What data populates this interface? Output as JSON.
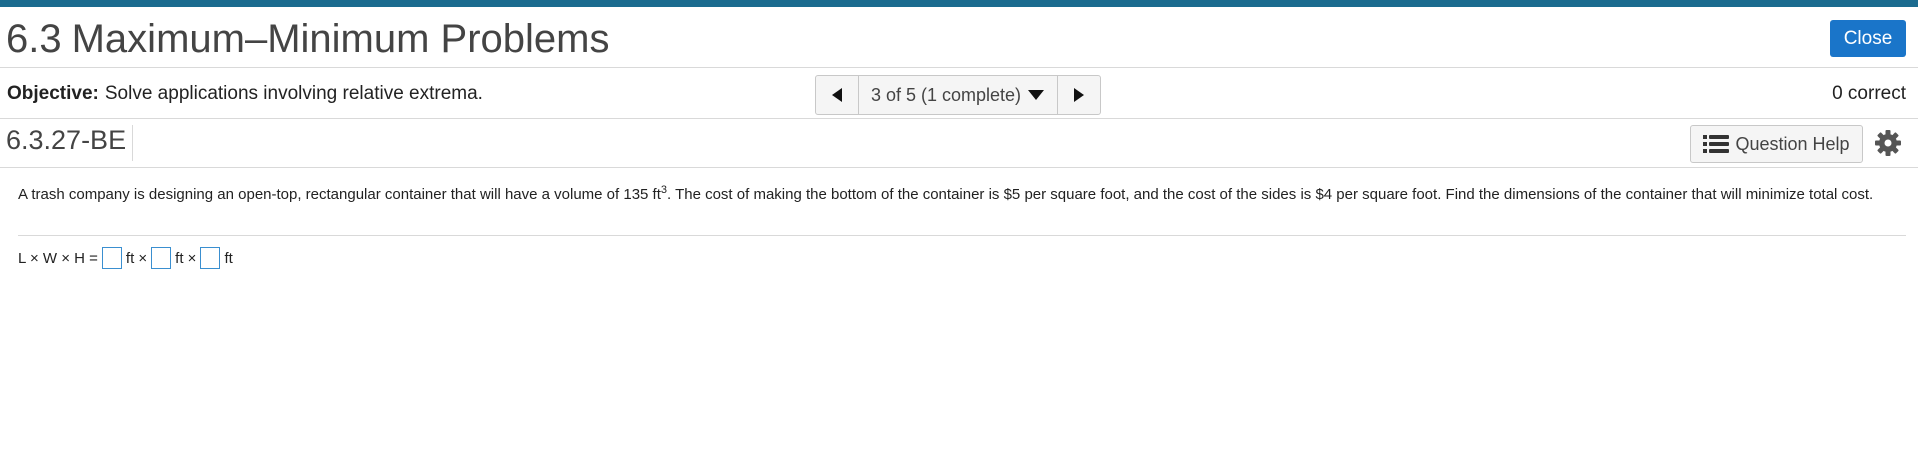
{
  "header": {
    "section_number": "6.3",
    "section_title": "Maximum–Minimum Problems",
    "close_label": "Close"
  },
  "objective": {
    "label": "Objective:",
    "text": "Solve applications involving relative extrema."
  },
  "navigation": {
    "position_text": "3 of 5 (1 complete)"
  },
  "score": {
    "text": "0 correct"
  },
  "question": {
    "id": "6.3.27-BE",
    "help_label": "Question Help",
    "text_before_sup": "A trash company is designing an open-top, rectangular container that will have a volume of 135 ft",
    "superscript": "3",
    "text_after_sup": ". The cost of making the bottom of the container is $5 per square foot, and the cost of the sides is $4 per square foot. Find the dimensions of the container that will minimize total cost.",
    "answer_prefix": "L × W × H =",
    "unit_1": "ft ×",
    "unit_2": "ft ×",
    "unit_3": "ft"
  },
  "colors": {
    "top_bar": "#1b6b8f",
    "close_button": "#1a75c9",
    "answer_box_border": "#3a8fd0"
  },
  "icons": {
    "prev": "triangle-left-icon",
    "next": "triangle-right-icon",
    "dropdown": "caret-down-icon",
    "help": "list-icon",
    "settings": "gear-icon"
  }
}
